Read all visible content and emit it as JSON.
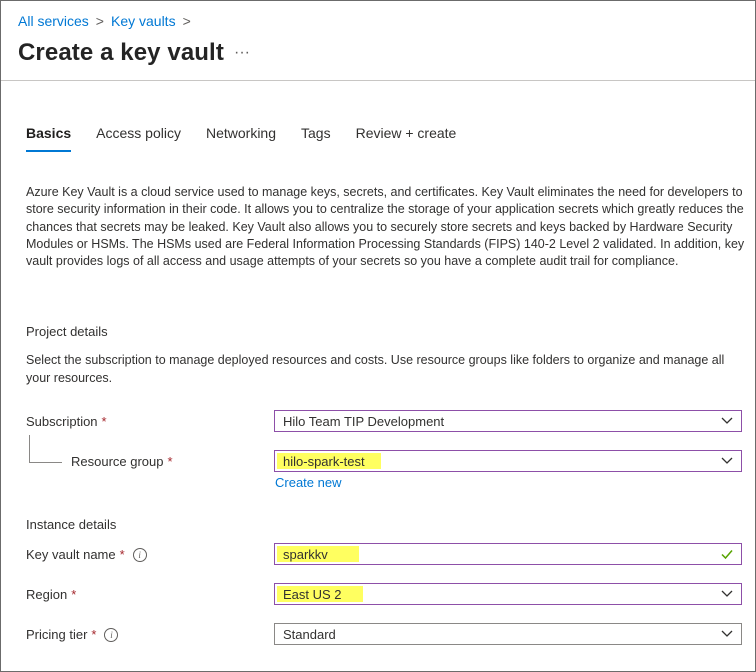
{
  "breadcrumb": {
    "items": [
      "All services",
      "Key vaults"
    ],
    "separator": ">"
  },
  "page": {
    "title": "Create a key vault",
    "more": "···"
  },
  "tabs": [
    "Basics",
    "Access policy",
    "Networking",
    "Tags",
    "Review + create"
  ],
  "active_tab": "Basics",
  "description": "Azure Key Vault is a cloud service used to manage keys, secrets, and certificates. Key Vault eliminates the need for developers to store security information in their code. It allows you to centralize the storage of your application secrets which greatly reduces the chances that secrets may be leaked. Key Vault also allows you to securely store secrets and keys backed by Hardware Security Modules or HSMs. The HSMs used are Federal Information Processing Standards (FIPS) 140-2 Level 2 validated. In addition, key vault provides logs of all access and usage attempts of your secrets so you have a complete audit trail for compliance.",
  "project": {
    "title": "Project details",
    "desc": "Select the subscription to manage deployed resources and costs. Use resource groups like folders to organize and manage all your resources.",
    "subscription_label": "Subscription",
    "subscription_value": "Hilo Team TIP Development",
    "resource_group_label": "Resource group",
    "resource_group_value": "hilo-spark-test",
    "create_new": "Create new"
  },
  "instance": {
    "title": "Instance details",
    "name_label": "Key vault name",
    "name_value": "sparkkv",
    "region_label": "Region",
    "region_value": "East US 2",
    "pricing_label": "Pricing tier",
    "pricing_value": "Standard"
  },
  "required_mark": "*",
  "info_glyph": "i",
  "colors": {
    "accent": "#0078d4",
    "required": "#a4262c",
    "highlight": "#ffff57",
    "valid": "#57a300",
    "focus_border": "#8d4fa8"
  }
}
